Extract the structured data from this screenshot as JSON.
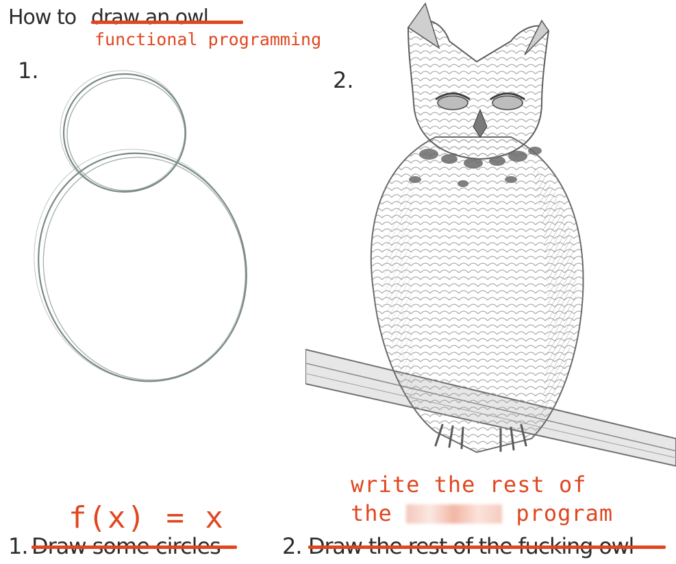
{
  "title": {
    "prefix": "How to",
    "struck": "draw an owl",
    "replacement": "functional programming"
  },
  "steps": {
    "step1_number": "1.",
    "step2_number": "2."
  },
  "captions": {
    "caption1_prefix": "1.",
    "caption1_struck": "Draw some circles",
    "caption1_replacement": "f(x) = x",
    "caption2_prefix": "2.",
    "caption2_struck": "Draw the rest of the fucking owl",
    "caption2_replacement_line1": "write the rest of",
    "caption2_replacement_line2_start": "the",
    "caption2_replacement_line2_end": "program"
  },
  "colors": {
    "annotation": "#e0461f",
    "text": "#2b2b2b",
    "pencil": "#7a8a86"
  },
  "icons": {
    "circles_sketch": "pencil-circles-sketch",
    "owl_drawing": "owl-on-branch-drawing",
    "censor_blur": "blurred-word"
  }
}
